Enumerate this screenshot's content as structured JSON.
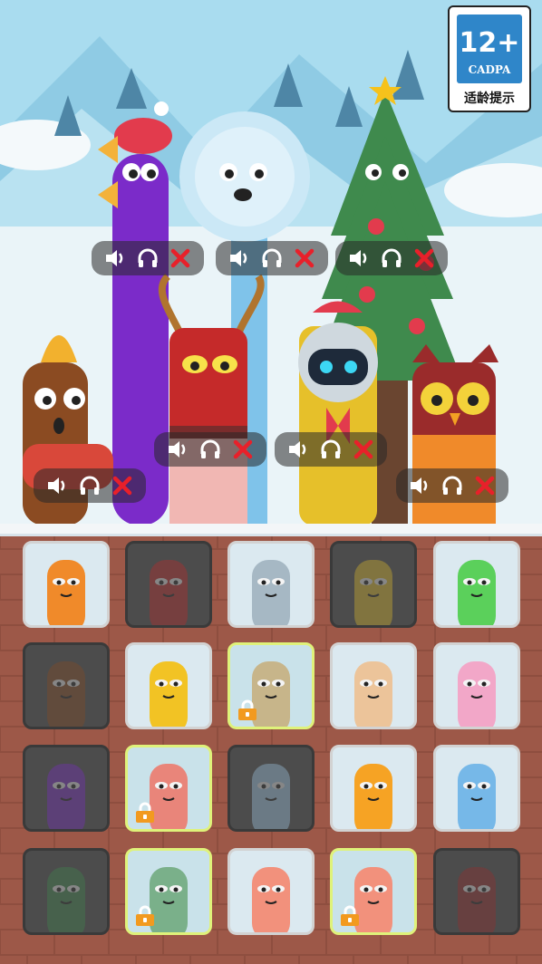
{
  "rating": {
    "age": "12+",
    "org": "CADPA",
    "tip": "适龄提示"
  },
  "controls": [
    {
      "id": "trumpet",
      "sound": "speaker-icon",
      "solo": "headphones-icon",
      "remove": "close-x-icon"
    },
    {
      "id": "snowflake",
      "sound": "speaker-icon",
      "solo": "headphones-icon",
      "remove": "close-x-icon"
    },
    {
      "id": "tree",
      "sound": "speaker-icon",
      "solo": "headphones-icon",
      "remove": "close-x-icon"
    },
    {
      "id": "reindeer",
      "sound": "speaker-icon",
      "solo": "headphones-icon",
      "remove": "close-x-icon"
    },
    {
      "id": "robot",
      "sound": "speaker-icon",
      "solo": "headphones-icon",
      "remove": "close-x-icon"
    },
    {
      "id": "bell",
      "sound": "speaker-icon",
      "solo": "headphones-icon",
      "remove": "close-x-icon"
    },
    {
      "id": "owl",
      "sound": "speaker-icon",
      "solo": "headphones-icon",
      "remove": "close-x-icon"
    }
  ],
  "colors": {
    "sky": "#a9dcef",
    "snow": "#f3f6f8",
    "brick": "#8e4e3f",
    "lock_border": "#dff27a",
    "close": "#e8202a"
  },
  "grid": [
    [
      {
        "name": "earmuffs-character",
        "state": "unlocked",
        "color": "#f08a2a"
      },
      {
        "name": "reindeer-character",
        "state": "in-use",
        "color": "#c52a2a"
      },
      {
        "name": "candy-horns-character",
        "state": "unlocked",
        "color": "#a6b8c4"
      },
      {
        "name": "robot-character",
        "state": "in-use",
        "color": "#e6c02a"
      },
      {
        "name": "wreath-character",
        "state": "unlocked",
        "color": "#5bd05b"
      }
    ],
    [
      {
        "name": "bell-character",
        "state": "in-use",
        "color": "#8b4b22"
      },
      {
        "name": "visor-santa-character",
        "state": "unlocked",
        "color": "#f2c324"
      },
      {
        "name": "crown-glasses-character",
        "state": "locked",
        "color": "#c7b58a"
      },
      {
        "name": "angel-character",
        "state": "unlocked",
        "color": "#ecc49a"
      },
      {
        "name": "candy-cane-character",
        "state": "unlocked",
        "color": "#f2a7c8"
      }
    ],
    [
      {
        "name": "trumpet-character",
        "state": "in-use",
        "color": "#7b2bc9"
      },
      {
        "name": "gift-wrap-character",
        "state": "locked",
        "color": "#e9857a"
      },
      {
        "name": "snowflake-character",
        "state": "in-use",
        "color": "#a7d2ef"
      },
      {
        "name": "blue-hat-character",
        "state": "unlocked",
        "color": "#f6a324"
      },
      {
        "name": "unicorn-character",
        "state": "unlocked",
        "color": "#76b8e8"
      }
    ],
    [
      {
        "name": "tree-character",
        "state": "in-use",
        "color": "#3f8a4d"
      },
      {
        "name": "santa-beard-character",
        "state": "locked",
        "color": "#7ab08a"
      },
      {
        "name": "bowtie-character",
        "state": "unlocked",
        "color": "#f2917c"
      },
      {
        "name": "bow-character",
        "state": "locked",
        "color": "#f2917c"
      },
      {
        "name": "owl-character",
        "state": "in-use",
        "color": "#9a2b2b"
      }
    ]
  ]
}
